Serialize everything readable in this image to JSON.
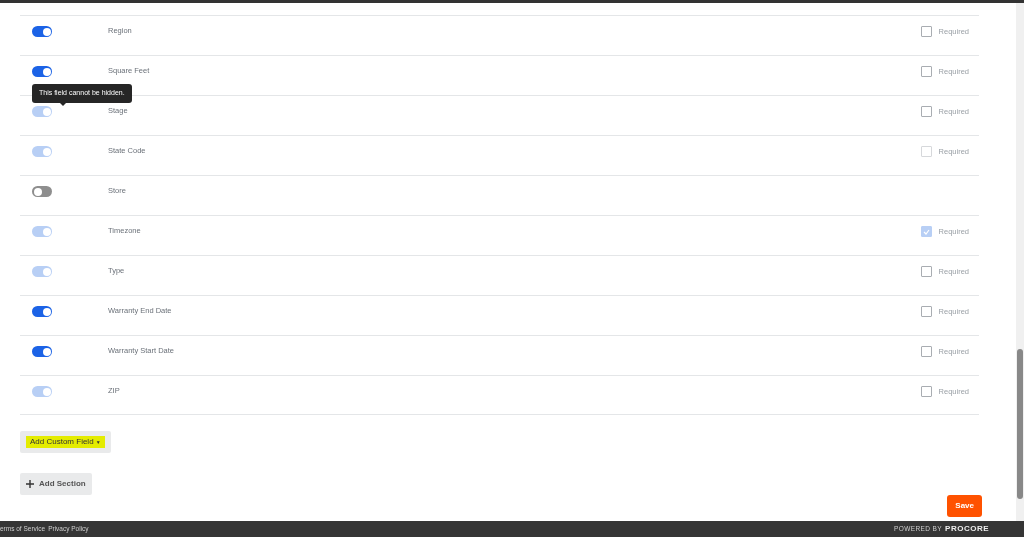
{
  "fields": [
    {
      "label": "Region",
      "on": true,
      "disabled": false,
      "required": {
        "label": "Required",
        "checked": false,
        "disabled": false
      }
    },
    {
      "label": "Square Feet",
      "on": true,
      "disabled": false,
      "required": {
        "label": "Required",
        "checked": false,
        "disabled": false
      }
    },
    {
      "label": "Stage",
      "on": true,
      "disabled": true,
      "tooltip": "This field cannot be hidden.",
      "required": {
        "label": "Required",
        "checked": false,
        "disabled": false
      }
    },
    {
      "label": "State Code",
      "on": true,
      "disabled": true,
      "required": {
        "label": "Required",
        "checked": false,
        "disabled": true
      }
    },
    {
      "label": "Store",
      "on": false,
      "disabled": false
    },
    {
      "label": "Timezone",
      "on": true,
      "disabled": true,
      "required": {
        "label": "Required",
        "checked": true,
        "disabled": true
      }
    },
    {
      "label": "Type",
      "on": true,
      "disabled": true,
      "required": {
        "label": "Required",
        "checked": false,
        "disabled": false
      }
    },
    {
      "label": "Warranty End Date",
      "on": true,
      "disabled": false,
      "required": {
        "label": "Required",
        "checked": false,
        "disabled": false
      }
    },
    {
      "label": "Warranty Start Date",
      "on": true,
      "disabled": false,
      "required": {
        "label": "Required",
        "checked": false,
        "disabled": false
      }
    },
    {
      "label": "ZIP",
      "on": true,
      "disabled": true,
      "required": {
        "label": "Required",
        "checked": false,
        "disabled": false
      }
    }
  ],
  "add_custom_field": {
    "label": "Add Custom Field",
    "icon": "▼"
  },
  "add_section": {
    "label": "Add Section"
  },
  "save": {
    "label": "Save"
  },
  "footer": {
    "links": [
      "erms of Service",
      "Privacy Policy"
    ],
    "powered_by": "POWERED BY",
    "brand": "PROCORE"
  }
}
